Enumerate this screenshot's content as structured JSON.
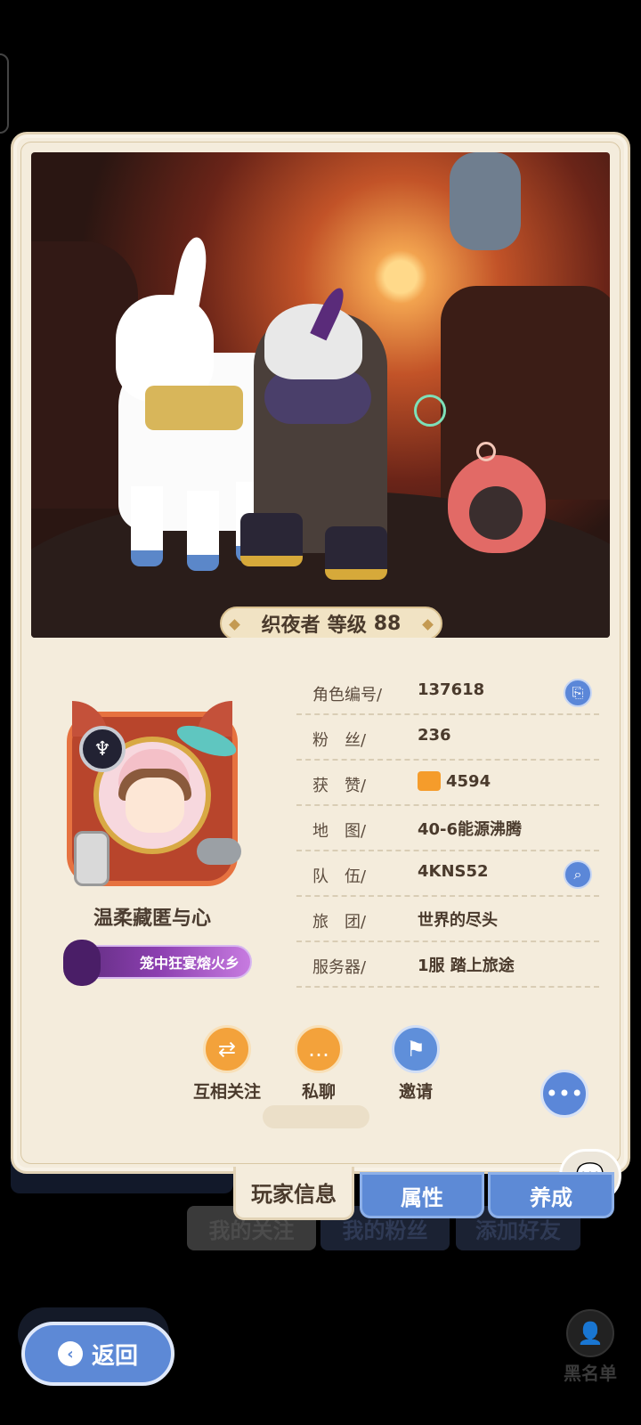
{
  "hero": {
    "class_name": "织夜者",
    "level_label": "等级",
    "level": "88"
  },
  "profile": {
    "name": "温柔藏匿与心",
    "title": "笼中狂宴熔火乡",
    "avatar_badge_icon": "trident-rank-icon"
  },
  "info": [
    {
      "label": "角色编号/",
      "value": "137618",
      "action_icon": "copy-icon"
    },
    {
      "label": "粉　丝/",
      "value": "236"
    },
    {
      "label": "获　赞/",
      "value": "4594",
      "value_icon": "thumbs-up-icon"
    },
    {
      "label": "地　图/",
      "value": "40-6能源沸腾"
    },
    {
      "label": "队　伍/",
      "value": "4KNS52",
      "action_icon": "search-icon"
    },
    {
      "label": "旅　团/",
      "value": "世界的尽头"
    },
    {
      "label": "服务器/",
      "value": "1服 踏上旅途"
    }
  ],
  "actions": {
    "follow": "互相关注",
    "chat": "私聊",
    "invite": "邀请"
  },
  "tabs": {
    "player_info": "玩家信息",
    "attributes": "属性",
    "growth": "养成"
  },
  "background_tabs": {
    "my_follows": "我的关注",
    "my_fans": "我的粉丝",
    "add_friend": "添加好友"
  },
  "nav": {
    "back": "返回",
    "blacklist": "黑名单"
  },
  "colors": {
    "card_bg": "#f4ecdc",
    "accent_blue": "#5d8ad6",
    "accent_orange": "#f3a23b",
    "text_dark": "#4a3a2c"
  }
}
